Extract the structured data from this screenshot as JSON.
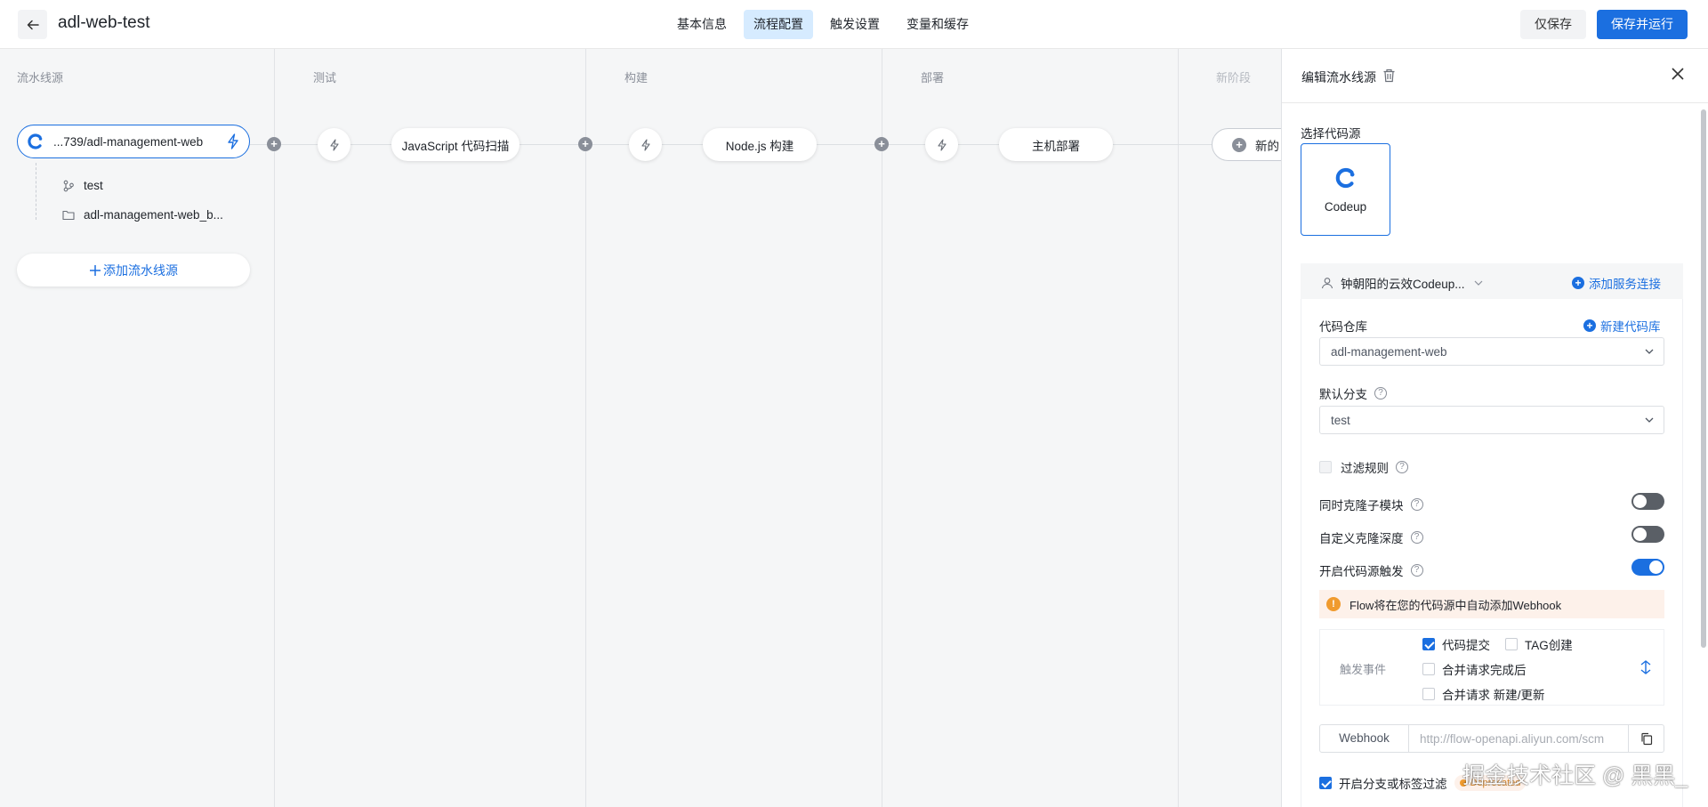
{
  "header": {
    "title": "adl-web-test",
    "tabs": [
      {
        "label": "基本信息",
        "active": false
      },
      {
        "label": "流程配置",
        "active": true
      },
      {
        "label": "触发设置",
        "active": false
      },
      {
        "label": "变量和缓存",
        "active": false
      }
    ],
    "save_only_label": "仅保存",
    "save_run_label": "保存并运行"
  },
  "canvas": {
    "columns": [
      {
        "label": "流水线源"
      },
      {
        "label": "测试"
      },
      {
        "label": "构建"
      },
      {
        "label": "部署"
      },
      {
        "label": "新阶段"
      }
    ],
    "source": {
      "name": "...739/adl-management-web",
      "branch": "test",
      "folder": "adl-management-web_b..."
    },
    "add_source_label": "添加流水线源",
    "jobs": [
      {
        "label": "JavaScript 代码扫描"
      },
      {
        "label": "Node.js 构建"
      },
      {
        "label": "主机部署"
      },
      {
        "label": "新的"
      }
    ]
  },
  "panel": {
    "title": "编辑流水线源",
    "select_source_label": "选择代码源",
    "codeup_label": "Codeup",
    "service_user": "钟朝阳的云效Codeup...",
    "add_service_link": "添加服务连接",
    "repo_label": "代码仓库",
    "new_repo_link": "新建代码库",
    "repo_value": "adl-management-web",
    "branch_label": "默认分支",
    "branch_value": "test",
    "filter_rules_label": "过滤规则",
    "clone_submodules_label": "同时克隆子模块",
    "clone_submodules_on": false,
    "custom_depth_label": "自定义克隆深度",
    "custom_depth_on": false,
    "source_trigger_label": "开启代码源触发",
    "source_trigger_on": true,
    "webhook_alert": "Flow将在您的代码源中自动添加Webhook",
    "trigger_events_label": "触发事件",
    "events": [
      {
        "label": "代码提交",
        "checked": true
      },
      {
        "label": "TAG创建",
        "checked": false
      },
      {
        "label": "合并请求完成后",
        "checked": false
      },
      {
        "label": "合并请求 新建/更新",
        "checked": false
      }
    ],
    "webhook_prefix": "Webhook",
    "webhook_url": "http://flow-openapi.aliyun.com/scm",
    "branch_tag_filter_label": "开启分支或标签过滤",
    "deprecated_badge": "Deprecated"
  },
  "watermark": "掘金技术社区 @ 黑黑_",
  "colors": {
    "accent": "#1b6fe0",
    "active_tab_bg": "#d6ebff",
    "warning": "#f09b2e"
  }
}
